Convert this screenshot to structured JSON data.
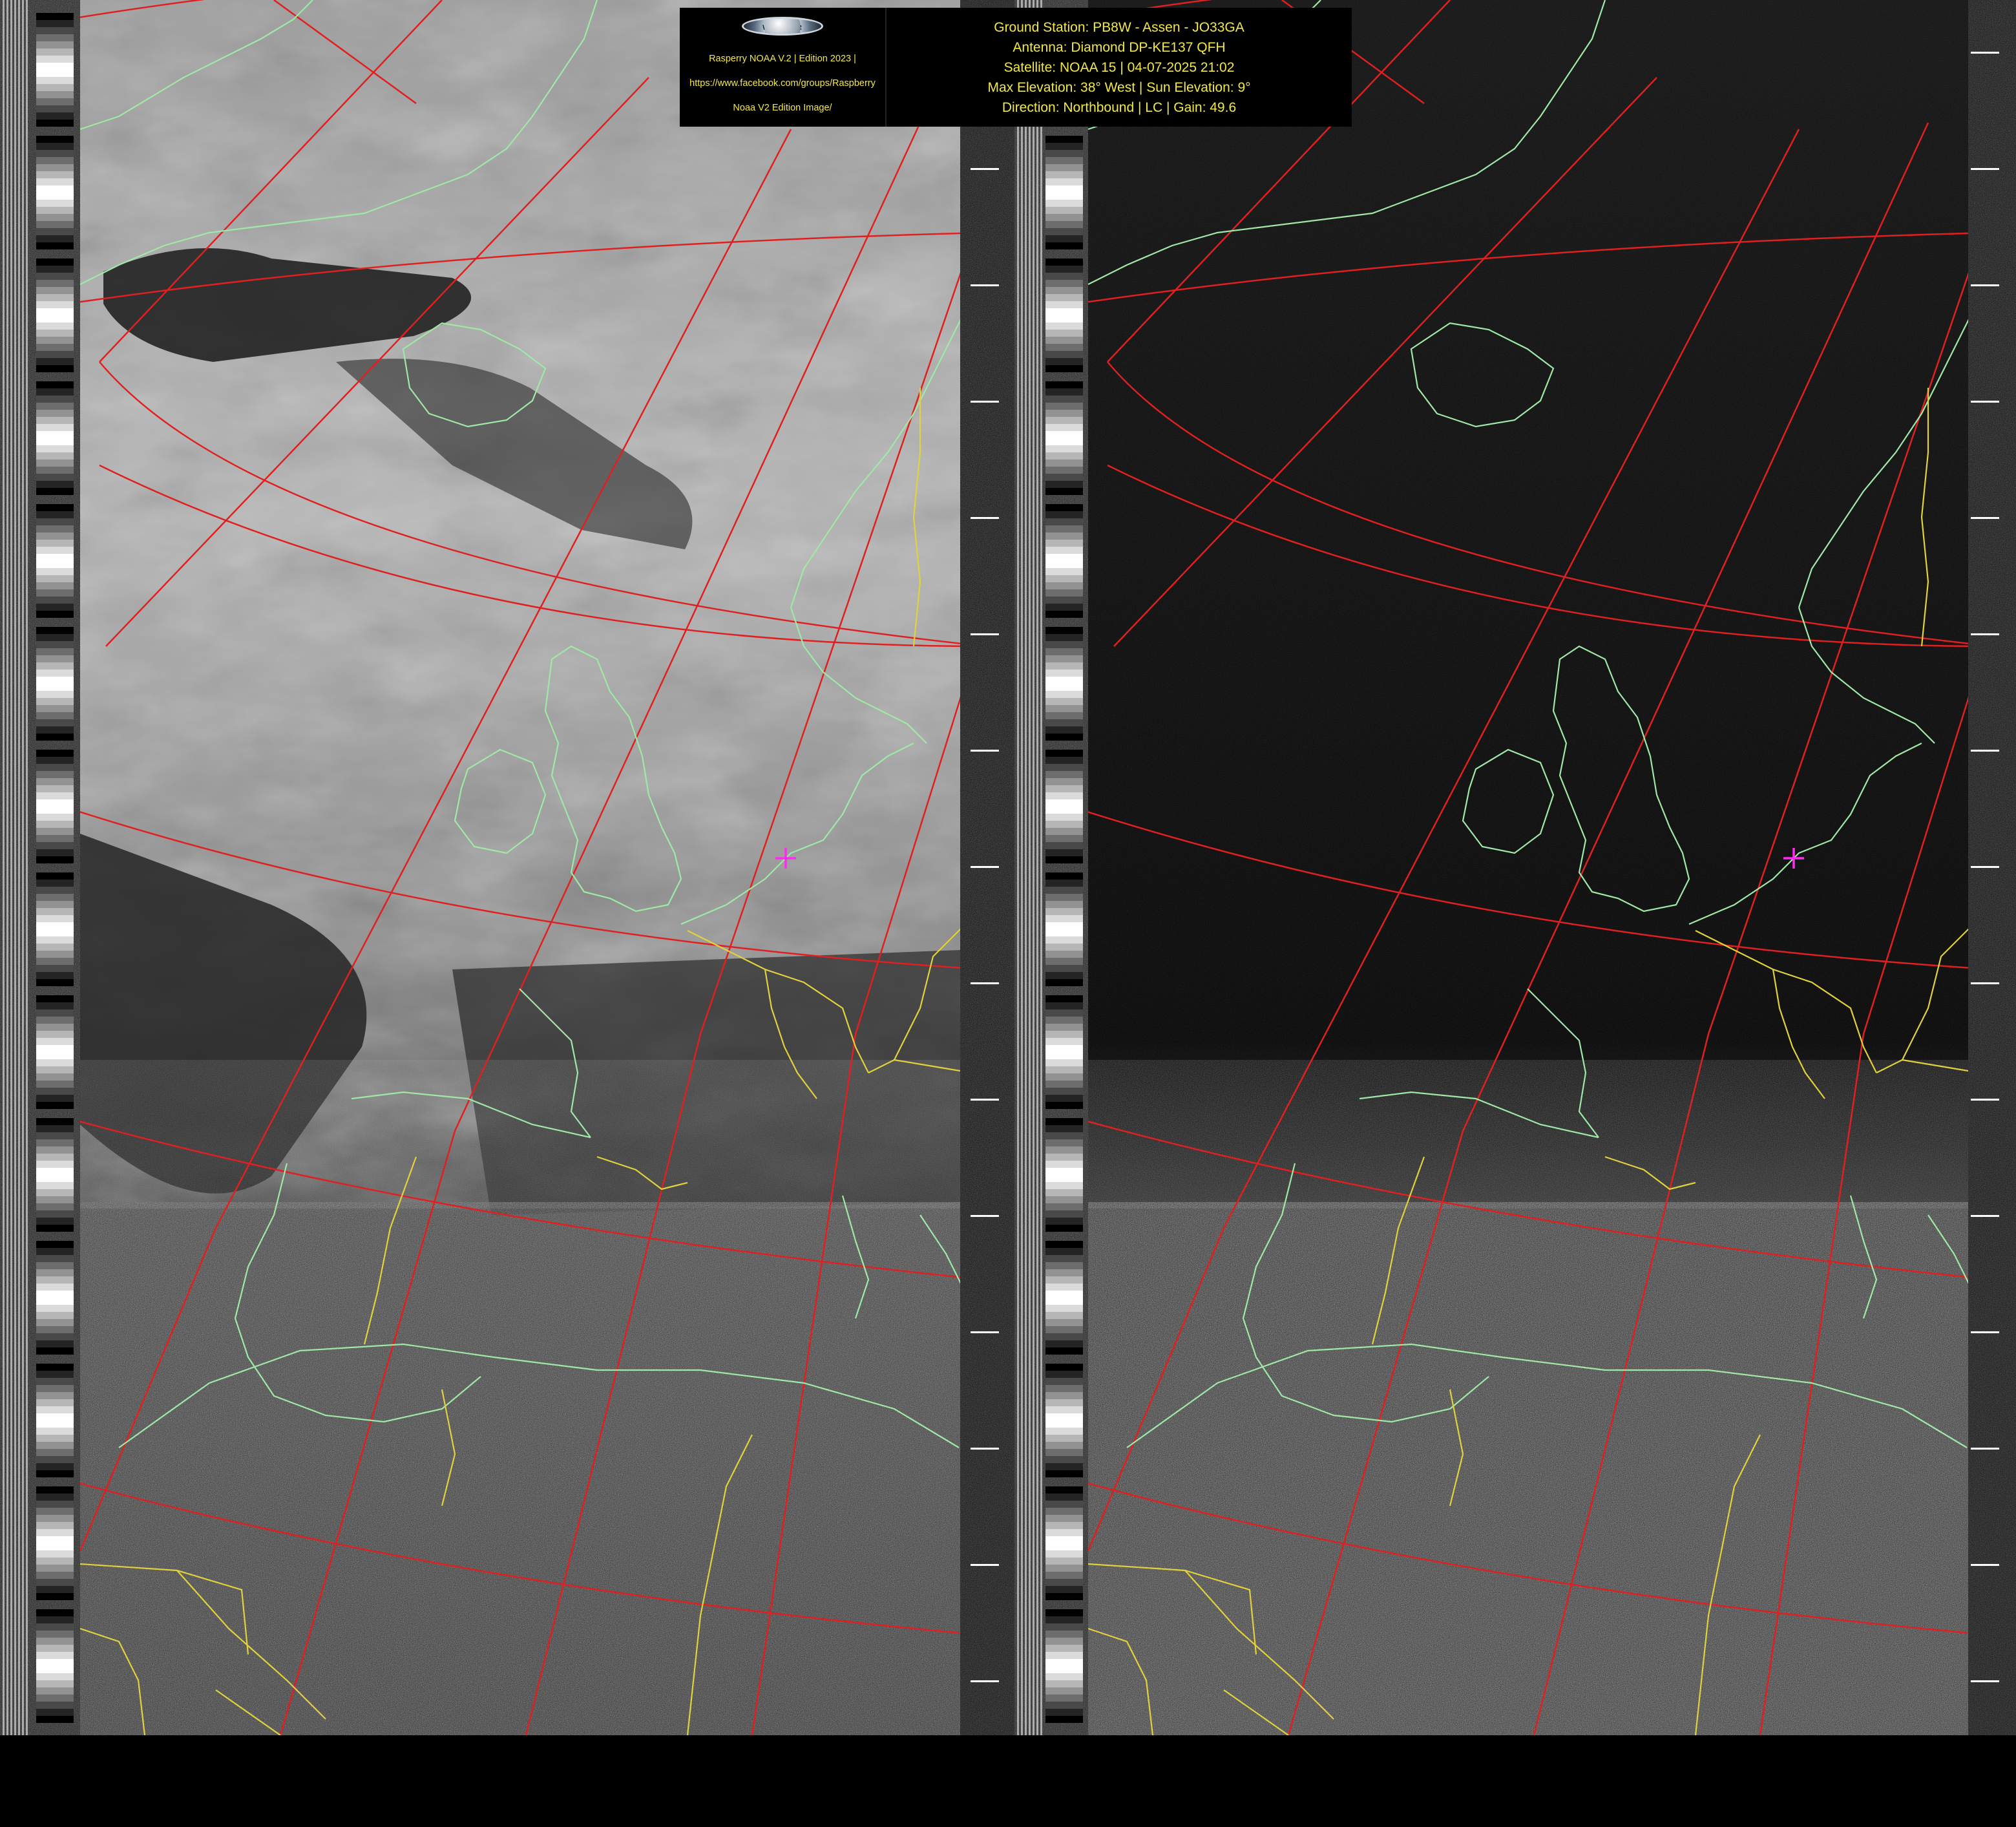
{
  "header": {
    "logo": {
      "icon": "satellite-dish-logo",
      "ring_text": "WEATHER SATELLITES",
      "caption_lines": [
        "Rasperry NOAA V.2 | Edition 2023 |",
        "https://www.facebook.com/groups/Raspberry",
        "Noaa V2 Edition Image/"
      ]
    },
    "info_lines": [
      "Ground Station: PB8W - Assen - JO33GA",
      "Antenna: Diamond DP-KE137 QFH",
      "Satellite: NOAA 15 | 04-07-2025 21:02",
      "Max Elevation: 38° West | Sun Elevation: 9°",
      "Direction: Northbound | LC | Gain: 49.6"
    ]
  },
  "colors": {
    "text_yellow": "#f2e84a",
    "grid_red": "#e02020",
    "coast_green": "#9fe8a6",
    "border_yellow": "#e0d23c",
    "marker_magenta": "#ff2cf0",
    "background": "#000000"
  },
  "panels": [
    {
      "id": "left",
      "kind": "visible",
      "contrast": "grey-clouds"
    },
    {
      "id": "right",
      "kind": "infrared",
      "contrast": "dark"
    }
  ],
  "station_marker": {
    "icon": "station-crosshair-icon",
    "location": "Assen"
  }
}
